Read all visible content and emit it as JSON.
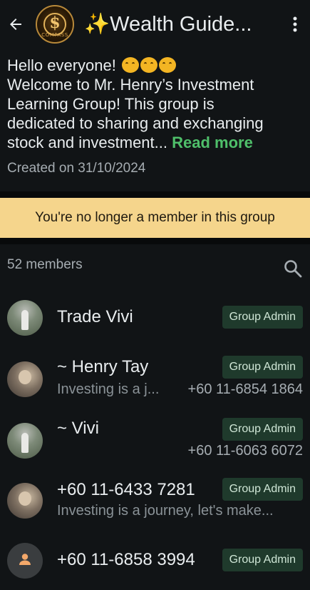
{
  "header": {
    "title": "✨Wealth Guide...",
    "logo_text": "COMPASS",
    "logo_symbol": "$"
  },
  "description": {
    "greeting": "Hello everyone!",
    "line2": "Welcome to Mr. Henry’s Investment",
    "line3": "Learning Group! This group is",
    "line4": "dedicated to sharing and exchanging",
    "line5": "stock and investment...",
    "read_more": "Read more",
    "created": "Created on 31/10/2024"
  },
  "banner": {
    "text": "You're no longer a member in this group"
  },
  "members": {
    "count_label": "52 members",
    "list": [
      {
        "name": "Trade Vivi",
        "subtitle": "",
        "phone": "",
        "badge": "Group Admin",
        "avatar": "woman"
      },
      {
        "name": "~ Henry Tay",
        "subtitle": "Investing is a j...",
        "phone": "+60 11-6854 1864",
        "badge": "Group Admin",
        "avatar": "man"
      },
      {
        "name": "~ Vivi",
        "subtitle": "",
        "phone": "+60 11-6063 6072",
        "badge": "Group Admin",
        "avatar": "woman"
      },
      {
        "name": "+60 11-6433 7281",
        "subtitle": "Investing is a journey, let's make...",
        "phone": "",
        "badge": "Group Admin",
        "avatar": "man"
      },
      {
        "name": "+60 11-6858 3994",
        "subtitle": "",
        "phone": "",
        "badge": "Group Admin",
        "avatar": "default"
      }
    ]
  },
  "icons": {
    "back": "back-arrow-icon",
    "menu": "more-vertical-icon",
    "search": "search-icon",
    "default_avatar": "person-icon"
  },
  "colors": {
    "background": "#111416",
    "banner": "#f5d58c",
    "link": "#4fbf6a",
    "badge_bg": "#1f3a2c"
  }
}
